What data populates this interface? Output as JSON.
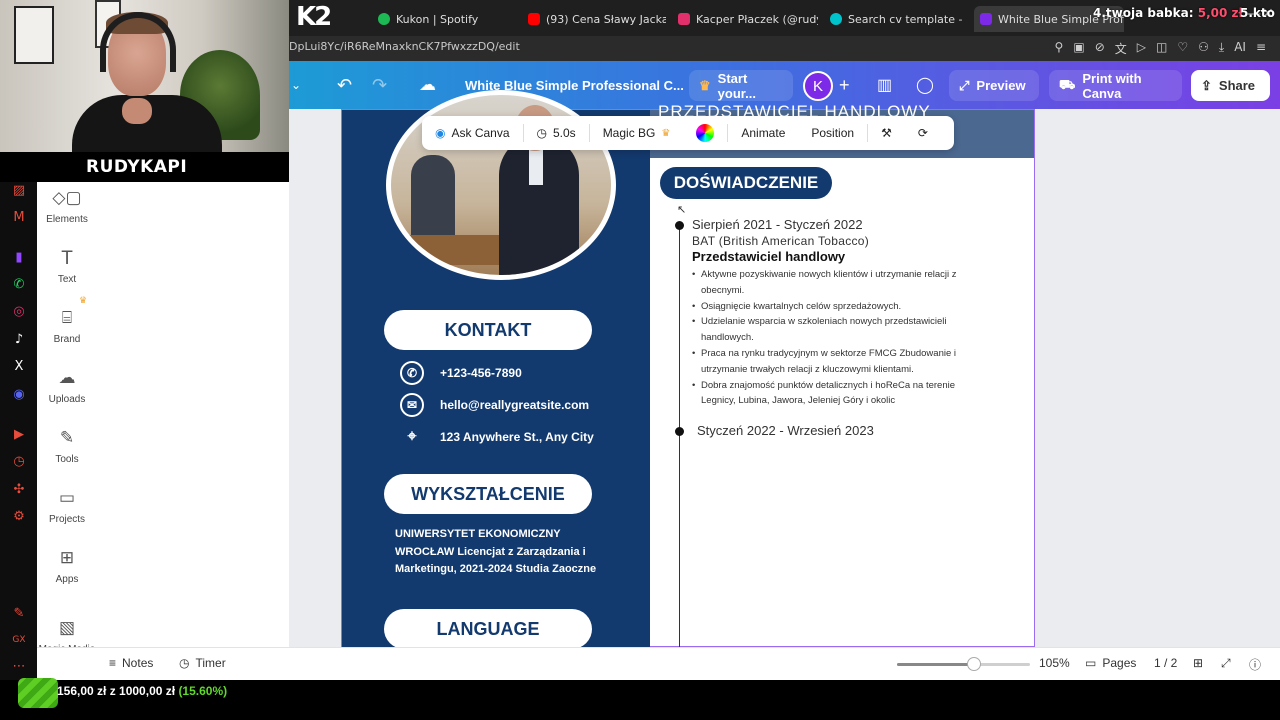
{
  "stream": {
    "streamer_name": "RUDYKAPI",
    "overlay_top_left": "2",
    "overlay_ticker_1": "4.twoja babka:",
    "overlay_ticker_1_amount": "5,00 zł",
    "overlay_ticker_2": "5.kto",
    "donation_text": "156,00 zł z 1000,00 zł",
    "donation_pct": "(15.60%)",
    "donation_progress": 0.156
  },
  "browser": {
    "tabs": [
      {
        "label": "Kukon | Spotify",
        "color": "#1db954"
      },
      {
        "label": "(93) Cena Sławy Jackas",
        "color": "#ff0000"
      },
      {
        "label": "Kacper Płaczek (@rudyk",
        "color": "#e1306c"
      },
      {
        "label": "Search cv template - Ca",
        "color": "#00c4cc"
      },
      {
        "label": "White Blue Simple Profes",
        "color": "#7d2ae8"
      }
    ],
    "url": "DpLui8Yc/iR6ReMnaxknCK7PfwxzzDQ/edit",
    "ai_label": "AI"
  },
  "canva": {
    "doc_title": "White Blue Simple Professional C...",
    "start_label": "Start your...",
    "avatar_letter": "K",
    "preview_label": "Preview",
    "print_label": "Print with Canva",
    "share_label": "Share",
    "toolbar": {
      "ask": "Ask Canva",
      "duration": "5.0s",
      "magic_bg": "Magic BG",
      "animate": "Animate",
      "position": "Position"
    },
    "sidebar": [
      {
        "label": "Elements",
        "icon": "elements-icon"
      },
      {
        "label": "Text",
        "icon": "text-icon"
      },
      {
        "label": "Brand",
        "icon": "brand-icon"
      },
      {
        "label": "Uploads",
        "icon": "uploads-icon"
      },
      {
        "label": "Tools",
        "icon": "tools-icon"
      },
      {
        "label": "Projects",
        "icon": "projects-icon"
      },
      {
        "label": "Apps",
        "icon": "apps-icon"
      },
      {
        "label": "Magic Media",
        "icon": "magic-media-icon"
      }
    ],
    "bottom": {
      "notes": "Notes",
      "timer": "Timer",
      "zoom": "105%",
      "zoom_level": 0.58,
      "pages": "Pages",
      "page_count": "1 / 2"
    }
  },
  "cv": {
    "job_title": "PRZEDSTAWICIEL HANDLOWY",
    "contact_heading": "KONTAKT",
    "phone": "+123-456-7890",
    "email": "hello@reallygreatsite.com",
    "address": "123 Anywhere St., Any City",
    "education_heading": "WYKSZTAŁCENIE",
    "education_text": "UNIWERSYTET EKONOMICZNY WROCŁAW Licencjat z Zarządzania i Marketingu, 2021-2024 Studia Zaoczne",
    "language_heading": "LANGUAGE",
    "experience_heading": "DOŚWIADCZENIE",
    "job1_dates": "Sierpień 2021 - Styczeń 2022",
    "job1_company": "BAT (British American Tobacco)",
    "job1_role": "Przedstawiciel handlowy",
    "job1_bullets": [
      "Aktywne pozyskiwanie nowych klientów i utrzymanie relacji z obecnymi.",
      "Osiągnięcie kwartalnych celów sprzedażowych.",
      "Udzielanie wsparcia w szkoleniach nowych przedstawicieli handlowych.",
      "Praca na rynku tradycyjnym w sektorze FMCG Zbudowanie i utrzymanie trwałych relacji z kluczowymi klientami.",
      "Dobra znajomość punktów detalicznych i hoReCa na terenie Legnicy, Lubina, Jawora, Jeleniej Góry i okolic"
    ],
    "job2_dates": "Styczeń 2022 - Wrzesień 2023"
  }
}
